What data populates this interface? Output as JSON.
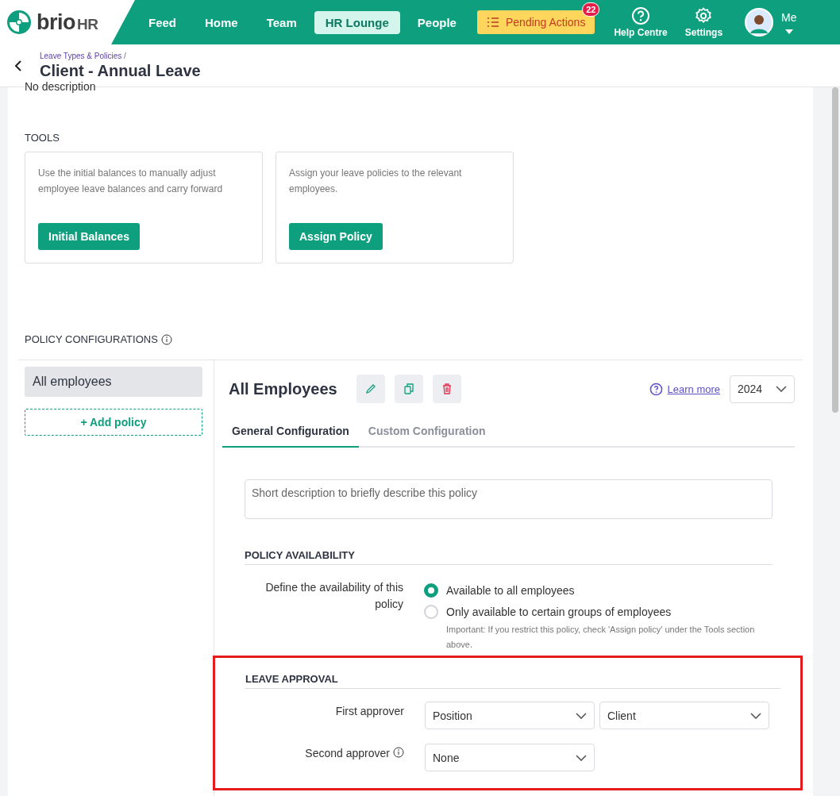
{
  "nav": {
    "logo": "brio",
    "logo_suffix": "HR",
    "items": [
      {
        "label": "Feed",
        "selected": false
      },
      {
        "label": "Home",
        "selected": false
      },
      {
        "label": "Team",
        "selected": false
      },
      {
        "label": "HR Lounge",
        "selected": true
      },
      {
        "label": "People",
        "selected": false
      }
    ],
    "pending": {
      "label": "Pending Actions",
      "count": "22"
    },
    "help": "Help Centre",
    "settings": "Settings",
    "user": "Me"
  },
  "breadcrumb": {
    "link": "Leave Types & Policies",
    "separator": "/"
  },
  "page_title": "Client - Annual Leave",
  "description": "No description",
  "tools": {
    "heading": "TOOLS",
    "cards": [
      {
        "text": "Use the initial balances to manually adjust employee leave balances and carry forward",
        "button": "Initial Balances"
      },
      {
        "text": "Assign your leave policies to the relevant employees.",
        "button": "Assign Policy"
      }
    ]
  },
  "policy_configurations": {
    "heading": "POLICY CONFIGURATIONS",
    "policies": [
      {
        "label": "All employees",
        "selected": true
      }
    ],
    "add_button": "+ Add policy",
    "detail": {
      "title": "All Employees",
      "learn_more": "Learn more",
      "year": "2024",
      "tabs": [
        {
          "label": "General Configuration",
          "selected": true
        },
        {
          "label": "Custom Configuration",
          "selected": false
        }
      ],
      "description_placeholder": "Short description to briefly describe this policy",
      "availability": {
        "heading": "POLICY AVAILABILITY",
        "label": "Define the availability of this policy",
        "options": [
          {
            "label": "Available to all employees",
            "selected": true
          },
          {
            "label": "Only available to certain groups of employees",
            "selected": false
          }
        ],
        "note": "Important: If you restrict this policy, check 'Assign policy' under the Tools section above."
      },
      "approval": {
        "heading": "LEAVE APPROVAL",
        "rows": [
          {
            "label": "First approver",
            "info": false,
            "selects": [
              "Position",
              "Client"
            ]
          },
          {
            "label": "Second approver",
            "info": true,
            "selects": [
              "None"
            ]
          }
        ]
      }
    }
  }
}
